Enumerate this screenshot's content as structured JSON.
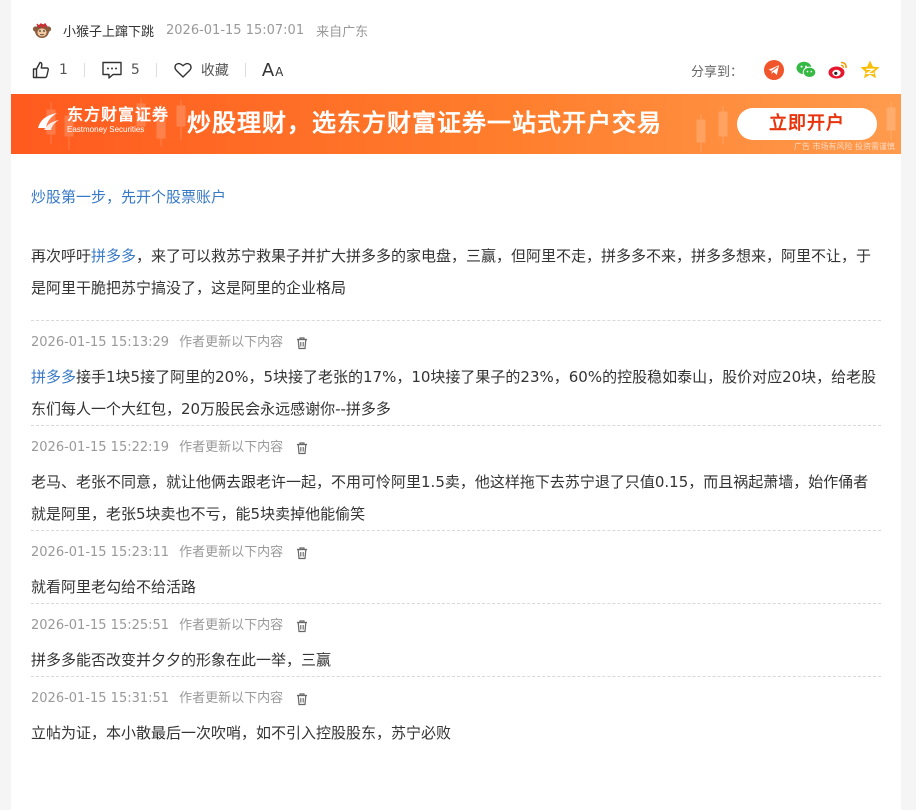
{
  "post": {
    "author": "小猴子上蹿下跳",
    "time": "2026-01-15 15:07:01",
    "location": "来自广东"
  },
  "toolbar": {
    "like_count": "1",
    "comment_count": "5",
    "favorite_label": "收藏",
    "font_big": "A",
    "font_small": "A",
    "share_label": "分享到："
  },
  "share_icons": [
    "telegram-share-icon",
    "wechat-share-icon",
    "weibo-share-icon",
    "qzone-share-icon"
  ],
  "ad": {
    "brand_cn": "东方财富证券",
    "brand_en": "Eastmoney Securities",
    "slogan": "炒股理财，选东方财富证券一站式开户交易",
    "cta": "立即开户",
    "tag": "广告 市场有风险 投资需谨慎"
  },
  "promo_link": "炒股第一步，先开个股票账户",
  "main": {
    "prefix": "再次呼吁",
    "link": "拼多多",
    "text": "，来了可以救苏宁救果子并扩大拼多多的家电盘，三赢，但阿里不走，拼多多不来，拼多多想来，阿里不让，于是阿里干脆把苏宁搞没了，这是阿里的企业格局"
  },
  "update_label": "作者更新以下内容",
  "updates": [
    {
      "time": "2026-01-15 15:13:29",
      "link": "拼多多",
      "text": "接手1块5接了阿里的20%，5块接了老张的17%，10块接了果子的23%，60%的控股稳如泰山，股价对应20块，给老股东们每人一个大红包，20万股民会永远感谢你--拼多多"
    },
    {
      "time": "2026-01-15 15:22:19",
      "link": "",
      "text": "老马、老张不同意，就让他俩去跟老许一起，不用可怜阿里1.5卖，他这样拖下去苏宁退了只值0.15，而且祸起萧墙，始作俑者就是阿里，老张5块卖也不亏，能5块卖掉他能偷笑"
    },
    {
      "time": "2026-01-15 15:23:11",
      "link": "",
      "text": "就看阿里老勾给不给活路"
    },
    {
      "time": "2026-01-15 15:25:51",
      "link": "",
      "text": "拼多多能否改变并夕夕的形象在此一举，三赢"
    },
    {
      "time": "2026-01-15 15:31:51",
      "link": "",
      "text": "立帖为证，本小散最后一次吹哨，如不引入控股股东，苏宁必败"
    }
  ],
  "colors": {
    "link": "#3779c7",
    "banner_start": "#ff5a1f",
    "banner_end": "#ff9b4d",
    "cta_text": "#e8340c"
  }
}
